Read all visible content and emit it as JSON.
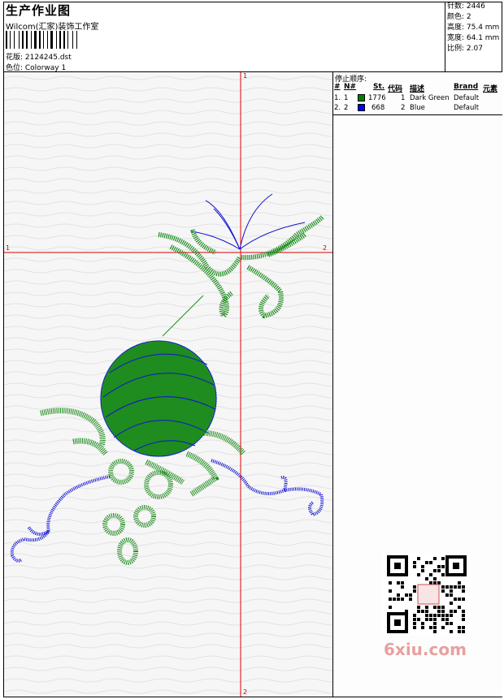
{
  "header": {
    "title": "生产作业图",
    "company": "Wilcom(汇家)装饰工作室",
    "design": "花版: 2124245.dst",
    "colorway": "色位:  Colorway 1"
  },
  "stats": {
    "stitches": "针数: 2446",
    "colors": "颜色: 2",
    "height": "高度: 75.4 mm",
    "width": "宽度: 64.1 mm",
    "ratio": "比例: 2.07"
  },
  "stop_sequence": {
    "title": "停止顺序:",
    "headers": {
      "hash": "#",
      "n": "N#",
      "st": "St.",
      "code": "代码",
      "desc": "描述",
      "brand": "Brand",
      "elem": "元素"
    },
    "rows": [
      {
        "idx": "1.",
        "n": "1",
        "color": "#008000",
        "st": "1776",
        "code": "1",
        "desc": "Dark Green",
        "brand": "Default"
      },
      {
        "idx": "2.",
        "n": "2",
        "color": "#0000ff",
        "st": "668",
        "code": "2",
        "desc": "Blue",
        "brand": "Default"
      }
    ]
  },
  "axes": {
    "top": "1",
    "bottom": "2",
    "left": "1",
    "right": "2"
  },
  "watermark": {
    "text": "6xiu.com",
    "seal": "汉初图库"
  },
  "colors": {
    "green": "#1e8c1e",
    "blue": "#1414d2",
    "axis": "#e00000"
  }
}
